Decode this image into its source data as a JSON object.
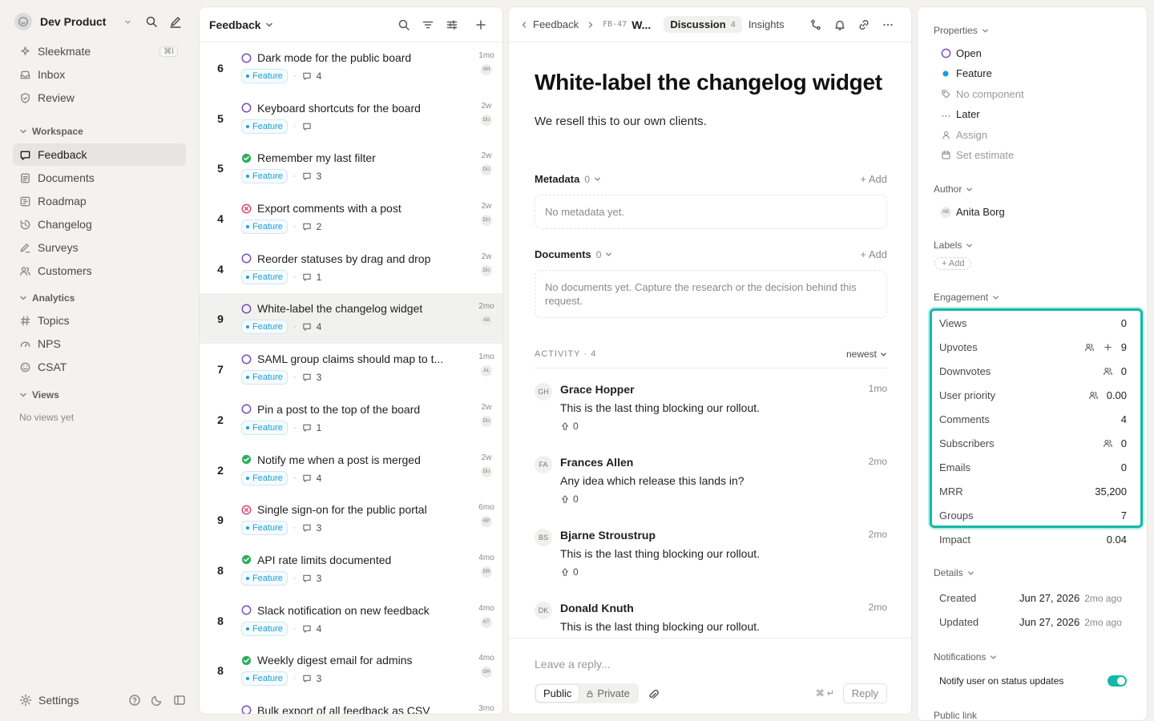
{
  "workspace": {
    "name": "Dev Product"
  },
  "nav_top": [
    {
      "label": "Sleekmate",
      "icon": "sparkle-icon",
      "kbd": "⌘I"
    },
    {
      "label": "Inbox",
      "icon": "inbox-icon"
    },
    {
      "label": "Review",
      "icon": "shield-icon"
    }
  ],
  "sections": {
    "workspace": "Workspace",
    "analytics": "Analytics",
    "views": "Views",
    "views_empty": "No views yet"
  },
  "nav_workspace": [
    {
      "label": "Feedback",
      "icon": "chat-icon",
      "active": true
    },
    {
      "label": "Documents",
      "icon": "document-icon"
    },
    {
      "label": "Roadmap",
      "icon": "roadmap-icon"
    },
    {
      "label": "Changelog",
      "icon": "changelog-icon"
    },
    {
      "label": "Surveys",
      "icon": "survey-icon"
    },
    {
      "label": "Customers",
      "icon": "users-icon"
    }
  ],
  "nav_analytics": [
    {
      "label": "Topics",
      "icon": "hash-icon"
    },
    {
      "label": "NPS",
      "icon": "gauge-icon"
    },
    {
      "label": "CSAT",
      "icon": "smiley-icon"
    }
  ],
  "footer": {
    "settings": "Settings"
  },
  "list": {
    "title": "Feedback",
    "items": [
      {
        "score": "6",
        "title": "Dark mode for the public board",
        "status": "open",
        "tag": "Feature",
        "comments": "4",
        "age": "1mo",
        "avatar": "GH"
      },
      {
        "score": "5",
        "title": "Keyboard shortcuts for the board",
        "status": "open",
        "tag": "Feature",
        "comments": "",
        "age": "2w",
        "avatar": "DU"
      },
      {
        "score": "5",
        "title": "Remember my last filter",
        "status": "done",
        "tag": "Feature",
        "comments": "3",
        "age": "2w",
        "avatar": "DU"
      },
      {
        "score": "4",
        "title": "Export comments with a post",
        "status": "closed",
        "tag": "Feature",
        "comments": "2",
        "age": "2w",
        "avatar": "DU"
      },
      {
        "score": "4",
        "title": "Reorder statuses by drag and drop",
        "status": "open",
        "tag": "Feature",
        "comments": "1",
        "age": "2w",
        "avatar": "DU"
      },
      {
        "score": "9",
        "title": "White-label the changelog widget",
        "status": "open",
        "tag": "Feature",
        "comments": "4",
        "age": "2mo",
        "avatar": "AB",
        "selected": true
      },
      {
        "score": "7",
        "title": "SAML group claims should map to t...",
        "status": "open",
        "tag": "Feature",
        "comments": "3",
        "age": "1mo",
        "avatar": "AL"
      },
      {
        "score": "2",
        "title": "Pin a post to the top of the board",
        "status": "open",
        "tag": "Feature",
        "comments": "1",
        "age": "2w",
        "avatar": "DU"
      },
      {
        "score": "2",
        "title": "Notify me when a post is merged",
        "status": "done",
        "tag": "Feature",
        "comments": "4",
        "age": "2w",
        "avatar": "DU"
      },
      {
        "score": "9",
        "title": "Single sign-on for the public portal",
        "status": "closed",
        "tag": "Feature",
        "comments": "3",
        "age": "6mo",
        "avatar": "RP"
      },
      {
        "score": "8",
        "title": "API rate limits documented",
        "status": "done",
        "tag": "Feature",
        "comments": "3",
        "age": "4mo",
        "avatar": "DR"
      },
      {
        "score": "8",
        "title": "Slack notification on new feedback",
        "status": "open",
        "tag": "Feature",
        "comments": "4",
        "age": "4mo",
        "avatar": "KT"
      },
      {
        "score": "8",
        "title": "Weekly digest email for admins",
        "status": "done",
        "tag": "Feature",
        "comments": "3",
        "age": "4mo",
        "avatar": "GH"
      },
      {
        "score": "",
        "title": "Bulk export of all feedback as CSV",
        "status": "open",
        "tag": "",
        "comments": "",
        "age": "3mo",
        "avatar": ""
      }
    ]
  },
  "detail": {
    "breadcrumb_root": "Feedback",
    "key": "FB-47",
    "short_title": "W...",
    "tabs": [
      {
        "label": "Discussion",
        "count": "4",
        "active": true
      },
      {
        "label": "Insights",
        "count": ""
      }
    ],
    "title": "White-label the changelog widget",
    "description": "We resell this to our own clients.",
    "metadata": {
      "label": "Metadata",
      "count": "0",
      "add": "Add",
      "empty": "No metadata yet."
    },
    "documents": {
      "label": "Documents",
      "count": "0",
      "add": "Add",
      "empty": "No documents yet. Capture the research or the decision behind this request."
    },
    "activity": {
      "label": "ACTIVITY · 4",
      "sort": "newest"
    },
    "comments": [
      {
        "initials": "GH",
        "author": "Grace Hopper",
        "age": "1mo",
        "text": "This is the last thing blocking our rollout.",
        "votes": "0"
      },
      {
        "initials": "FA",
        "author": "Frances Allen",
        "age": "2mo",
        "text": "Any idea which release this lands in?",
        "votes": "0"
      },
      {
        "initials": "BS",
        "author": "Bjarne Stroustrup",
        "age": "2mo",
        "text": "This is the last thing blocking our rollout.",
        "votes": "0"
      },
      {
        "initials": "DK",
        "author": "Donald Knuth",
        "age": "2mo",
        "text": "This is the last thing blocking our rollout.",
        "votes": ""
      }
    ],
    "reply": {
      "placeholder": "Leave a reply...",
      "public": "Public",
      "private": "Private",
      "shortcut": "⌘ ↵",
      "button": "Reply"
    }
  },
  "properties": {
    "header": "Properties",
    "status": "Open",
    "type": "Feature",
    "component": "No component",
    "priority": "Later",
    "assign": "Assign",
    "estimate": "Set estimate",
    "author_header": "Author",
    "author_initials": "AB",
    "author": "Anita Borg",
    "labels_header": "Labels",
    "labels_add": "Add",
    "engagement_header": "Engagement",
    "engagement": [
      {
        "key": "Views",
        "value": "0",
        "icons": []
      },
      {
        "key": "Upvotes",
        "value": "9",
        "icons": [
          "users-icon",
          "plus-icon"
        ]
      },
      {
        "key": "Downvotes",
        "value": "0",
        "icons": [
          "users-icon"
        ]
      },
      {
        "key": "User priority",
        "value": "0.00",
        "icons": [
          "users-icon"
        ]
      },
      {
        "key": "Comments",
        "value": "4",
        "icons": []
      },
      {
        "key": "Subscribers",
        "value": "0",
        "icons": [
          "users-icon"
        ]
      },
      {
        "key": "Emails",
        "value": "0",
        "icons": []
      },
      {
        "key": "MRR",
        "value": "35,200",
        "icons": []
      },
      {
        "key": "Groups",
        "value": "7",
        "icons": []
      },
      {
        "key": "Impact",
        "value": "0.04",
        "icons": []
      }
    ],
    "details_header": "Details",
    "created_label": "Created",
    "created_date": "Jun 27, 2026",
    "created_ago": "2mo ago",
    "updated_label": "Updated",
    "updated_date": "Jun 27, 2026",
    "updated_ago": "2mo ago",
    "notifications_header": "Notifications",
    "notify_label": "Notify user on status updates",
    "notify_on": true,
    "public_link_header": "Public link"
  },
  "colors": {
    "accent": "#14b8a6",
    "feature": "#1a9fd8",
    "open": "#7c4dbe",
    "done": "#2fae5b",
    "closed": "#d43f6a"
  }
}
